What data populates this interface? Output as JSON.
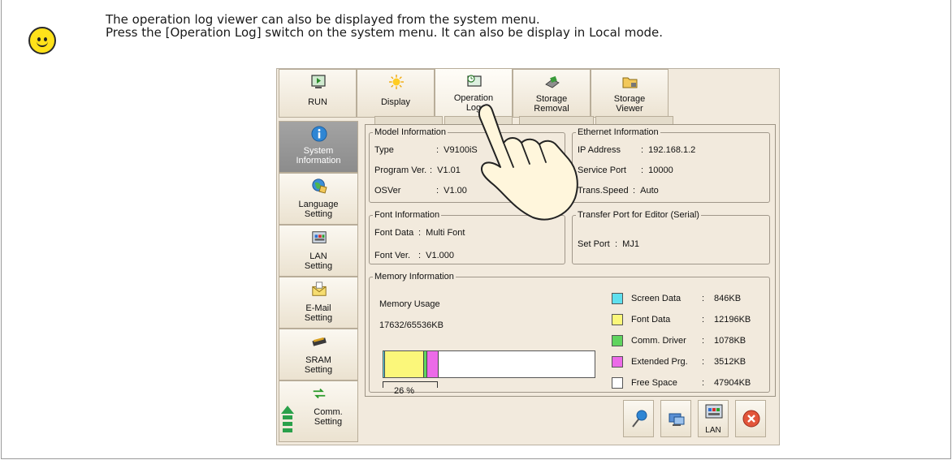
{
  "tip": {
    "icon": "smiley-icon",
    "line1": "The operation log viewer can also be displayed from the system menu.",
    "line2": "Press the [Operation Log] switch on the system menu. It can also be display in Local mode."
  },
  "toolbar": {
    "buttons": [
      {
        "label": "RUN",
        "icon": "run-icon"
      },
      {
        "label": "Display",
        "icon": "sun-icon"
      },
      {
        "label": "Operation Log",
        "icon": "operation-log-icon"
      },
      {
        "label": "Storage Removal",
        "icon": "storage-removal-icon"
      },
      {
        "label": "Storage Viewer",
        "icon": "folder-icon"
      }
    ],
    "selected": "Operation Log"
  },
  "sidebar": {
    "items": [
      {
        "label": "System Information",
        "icon": "info-icon",
        "selected": true
      },
      {
        "label": "Language Setting",
        "icon": "globe-icon"
      },
      {
        "label": "LAN Setting",
        "icon": "lan-icon"
      },
      {
        "label": "E-Mail Setting",
        "icon": "mail-icon"
      },
      {
        "label": "SRAM Setting",
        "icon": "sram-icon"
      },
      {
        "label": "Comm. Setting",
        "icon": "comm-icon"
      }
    ]
  },
  "model_info": {
    "title": "Model Information",
    "type_label": "Type",
    "type_value": "V9100iS",
    "program_label": "Program Ver.",
    "program_value": "V1.01",
    "os_label": "OSVer",
    "os_value": "V1.00"
  },
  "ethernet_info": {
    "title": "Ethernet Information",
    "ip_label": "IP Address",
    "ip_value": "192.168.1.2",
    "port_label": "Service Port",
    "port_value": "10000",
    "speed_label": "Trans.Speed",
    "speed_value": "Auto"
  },
  "font_info": {
    "title": "Font Information",
    "data_label": "Font Data",
    "data_value": "Multi Font",
    "ver_label": "Font Ver.",
    "ver_value": "V1.000"
  },
  "transfer_port": {
    "title": "Transfer Port for Editor (Serial)",
    "label": "Set Port",
    "value": "MJ1"
  },
  "memory_info": {
    "title": "Memory Information",
    "usage_label": "Memory Usage",
    "usage_value": "17632/65536KB",
    "usage_percent": "26 %",
    "legend": [
      {
        "name": "Screen Data",
        "value": "846KB",
        "color": "#5fe0ee"
      },
      {
        "name": "Font Data",
        "value": "12196KB",
        "color": "#fbf77a"
      },
      {
        "name": "Comm. Driver",
        "value": "1078KB",
        "color": "#60d45e"
      },
      {
        "name": "Extended Prg.",
        "value": "3512KB",
        "color": "#ec6ae8"
      },
      {
        "name": "Free Space",
        "value": "47904KB",
        "color": "#ffffff"
      }
    ]
  },
  "bottom_buttons": [
    {
      "icon": "pin-icon",
      "label": ""
    },
    {
      "icon": "network-pc-icon",
      "label": ""
    },
    {
      "icon": "lan-icon",
      "label": "LAN"
    },
    {
      "icon": "close-icon",
      "label": ""
    }
  ]
}
